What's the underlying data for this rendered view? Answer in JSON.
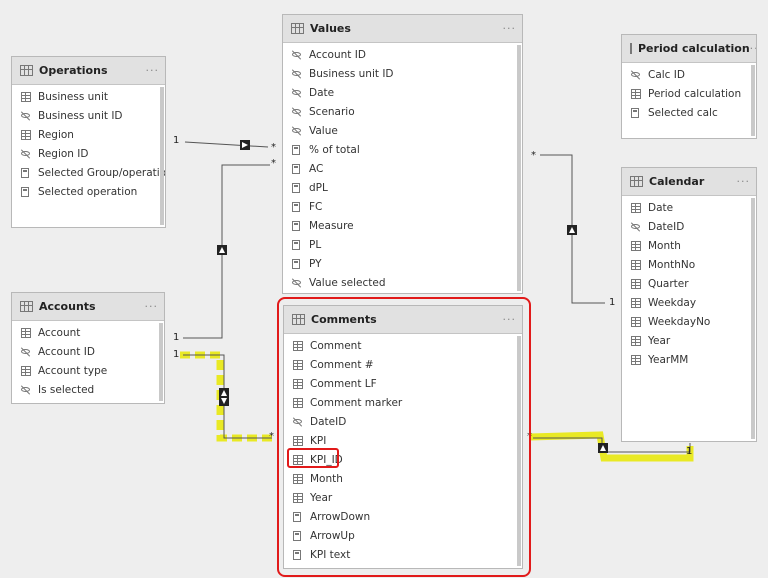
{
  "colors": {
    "background": "#eeeeee",
    "table_header": "#e1e1e1",
    "highlight_red": "#e11a1a",
    "highlight_yellow": "#e8e800",
    "line": "#555555"
  },
  "tables": {
    "operations": {
      "title": "Operations",
      "fields": [
        {
          "label": "Business unit",
          "icon": "grid"
        },
        {
          "label": "Business unit ID",
          "icon": "hidden"
        },
        {
          "label": "Region",
          "icon": "grid"
        },
        {
          "label": "Region ID",
          "icon": "hidden"
        },
        {
          "label": "Selected Group/operation",
          "icon": "calc"
        },
        {
          "label": "Selected operation",
          "icon": "calc"
        }
      ]
    },
    "values": {
      "title": "Values",
      "fields": [
        {
          "label": "Account ID",
          "icon": "hidden"
        },
        {
          "label": "Business unit ID",
          "icon": "hidden"
        },
        {
          "label": "Date",
          "icon": "hidden"
        },
        {
          "label": "Scenario",
          "icon": "hidden"
        },
        {
          "label": "Value",
          "icon": "hidden"
        },
        {
          "label": "% of total",
          "icon": "calc"
        },
        {
          "label": "AC",
          "icon": "calc"
        },
        {
          "label": "dPL",
          "icon": "calc"
        },
        {
          "label": "FC",
          "icon": "calc"
        },
        {
          "label": "Measure",
          "icon": "calc"
        },
        {
          "label": "PL",
          "icon": "calc"
        },
        {
          "label": "PY",
          "icon": "calc"
        },
        {
          "label": "Value selected",
          "icon": "hidden"
        }
      ]
    },
    "period": {
      "title": "Period calculation",
      "fields": [
        {
          "label": "Calc ID",
          "icon": "hidden"
        },
        {
          "label": "Period calculation",
          "icon": "grid"
        },
        {
          "label": "Selected calc",
          "icon": "calc"
        }
      ]
    },
    "calendar": {
      "title": "Calendar",
      "fields": [
        {
          "label": "Date",
          "icon": "grid"
        },
        {
          "label": "DateID",
          "icon": "hidden"
        },
        {
          "label": "Month",
          "icon": "grid"
        },
        {
          "label": "MonthNo",
          "icon": "grid"
        },
        {
          "label": "Quarter",
          "icon": "grid"
        },
        {
          "label": "Weekday",
          "icon": "grid"
        },
        {
          "label": "WeekdayNo",
          "icon": "grid"
        },
        {
          "label": "Year",
          "icon": "grid"
        },
        {
          "label": "YearMM",
          "icon": "grid"
        }
      ]
    },
    "accounts": {
      "title": "Accounts",
      "fields": [
        {
          "label": "Account",
          "icon": "grid"
        },
        {
          "label": "Account ID",
          "icon": "hidden"
        },
        {
          "label": "Account type",
          "icon": "grid"
        },
        {
          "label": "Is selected",
          "icon": "hidden"
        }
      ]
    },
    "comments": {
      "title": "Comments",
      "fields": [
        {
          "label": "Comment",
          "icon": "grid"
        },
        {
          "label": "Comment #",
          "icon": "grid"
        },
        {
          "label": "Comment LF",
          "icon": "grid"
        },
        {
          "label": "Comment marker",
          "icon": "grid"
        },
        {
          "label": "DateID",
          "icon": "hidden"
        },
        {
          "label": "KPI",
          "icon": "grid"
        },
        {
          "label": "KPI_ID",
          "icon": "grid"
        },
        {
          "label": "Month",
          "icon": "grid"
        },
        {
          "label": "Year",
          "icon": "grid"
        },
        {
          "label": "ArrowDown",
          "icon": "calc"
        },
        {
          "label": "ArrowUp",
          "icon": "calc"
        },
        {
          "label": "KPI text",
          "icon": "calc"
        }
      ]
    }
  },
  "more_label": "···",
  "relationships": {
    "one": "1",
    "many": "*"
  }
}
